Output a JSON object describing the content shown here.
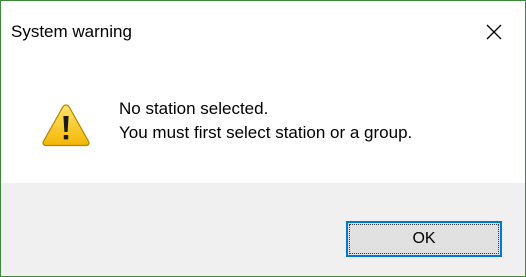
{
  "window": {
    "title": "System warning",
    "close_icon": "close-icon",
    "border_color": "#3c8a3c"
  },
  "message": {
    "icon": "warning-icon",
    "line1": "No station selected.",
    "line2": "You must first select station or a group."
  },
  "buttons": {
    "ok_label": "OK",
    "focus_color": "#0078d7"
  },
  "colors": {
    "footer_background": "#f0f0f0",
    "warning_yellow": "#f7c51e"
  }
}
